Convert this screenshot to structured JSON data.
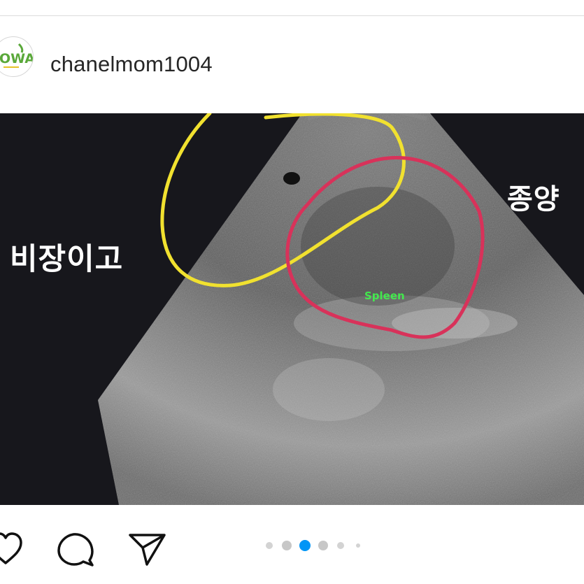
{
  "post": {
    "username": "chanelmom1004",
    "avatar_text": "OWA"
  },
  "media": {
    "labels": {
      "spleen": "비장이고",
      "tumor": "종양",
      "scan_tag": "Spleen"
    }
  },
  "actions": {
    "like_icon": "heart-icon",
    "comment_icon": "comment-icon",
    "share_icon": "send-icon"
  },
  "carousel": {
    "total": 6,
    "active_index": 2
  },
  "colors": {
    "accent_dot": "#0095f6",
    "annotation_yellow": "#f1e12f",
    "annotation_pink": "#d8325a"
  }
}
